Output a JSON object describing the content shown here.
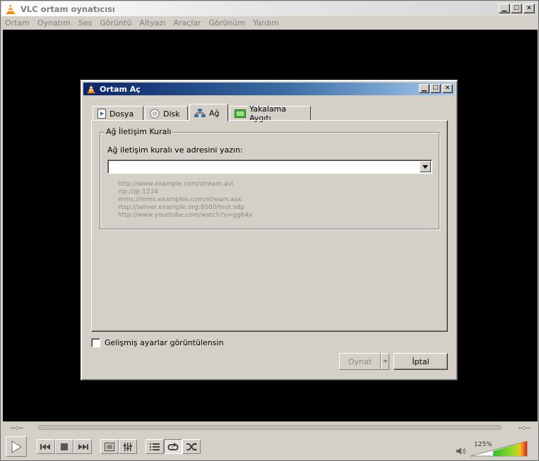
{
  "window": {
    "title": "VLC ortam oynatıcısı",
    "controls": [
      "_",
      "□",
      "×"
    ]
  },
  "menubar": [
    "Ortam",
    "Oynatım",
    "Ses",
    "Görüntü",
    "Altyazı",
    "Araçlar",
    "Görünüm",
    "Yardım"
  ],
  "player": {
    "time_elapsed": "--:--",
    "time_remaining": "--:--",
    "volume": "125%",
    "buttons": [
      "play-icon",
      "previous-icon",
      "stop-icon",
      "next-icon",
      "fullscreen-icon",
      "extended-settings-icon",
      "playlist-icon",
      "loop-icon",
      "shuffle-icon"
    ]
  },
  "dialog": {
    "title": "Ortam Aç",
    "tabs": [
      {
        "label": "Dosya",
        "icon": "file-icon"
      },
      {
        "label": "Disk",
        "icon": "disc-icon"
      },
      {
        "label": "Ağ",
        "icon": "network-icon",
        "active": true
      },
      {
        "label": "Yakalama Aygıtı",
        "icon": "capture-device-icon"
      }
    ],
    "group_title": "Ağ İletişim Kuralı",
    "address_label": "Ağ iletişim kuralı ve adresini yazın:",
    "address_value": "",
    "examples": [
      "http://www.example.com/stream.avi",
      "rtp://@:1234",
      "mms://mms.examples.com/stream.asx",
      "rtsp://server.example.org:8080/test.sdp",
      "http://www.yourtube.com/watch?v=gg64x"
    ],
    "advanced_label": "Gelişmiş ayarlar görüntülensin",
    "advanced_checked": false,
    "play_label": "Oynat",
    "cancel_label": "İptal"
  }
}
